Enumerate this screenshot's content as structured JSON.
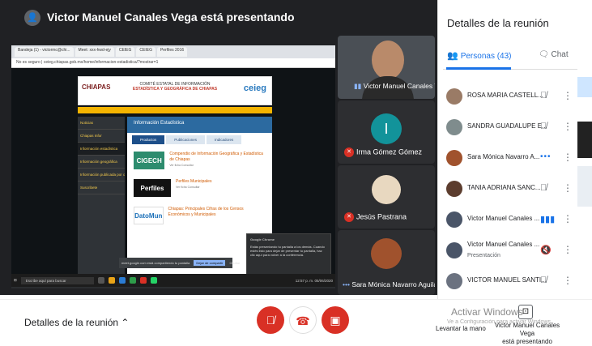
{
  "presenter_bar": {
    "title": "Victor Manuel Canales Vega está presentando"
  },
  "shared_screen": {
    "browser_tabs": [
      "Bandeja (1) - victormc@chi...",
      "Meet: xxx-hwd-ejy",
      "CEIEG",
      "CEIEG",
      "Perfiles 2016"
    ],
    "address": "No es seguro | ceieg.chiapas.gob.mx/home/informacion-estadistica/?mostrar=1",
    "site": {
      "brand_left": "CHIAPAS",
      "brand_center_line1": "COMITÉ ESTATAL DE INFORMACIÓN",
      "brand_center_line2": "ESTADÍSTICA Y GEOGRÁFICA DE CHIAPAS",
      "brand_right": "ceieg",
      "menu": [
        "Noticias",
        "Chiapas Infor",
        "Información estadística",
        "Información geográfica",
        "Información publicada por otras organizaciones",
        "Suscribete"
      ],
      "panel_title": "Información Estadística",
      "panel_tabs": [
        "Productos",
        "Publicaciones",
        "Indicadores"
      ],
      "items": [
        {
          "logo": "CIGECH",
          "title": "Compendio de Información Geográfica y Estadística de Chiapas",
          "meta": "Ver ficha  Consultar"
        },
        {
          "logo": "Perfiles",
          "title": "Perfiles Municipales",
          "meta": "Ver ficha  Consultar"
        },
        {
          "logo": "DatoMun",
          "title": "Chiapas: Principales Cifras de los Censos Económicos y Municipales",
          "meta": ""
        }
      ]
    },
    "notification": {
      "app": "Google Chrome",
      "text": "Estás presentando tu pantalla a los demás. Cuando estés listo para dejar de presentar tu pantalla, haz clic aquí para volver a la conferencia."
    },
    "share_banner": {
      "text": "meet.google.com está compartiendo tu pantalla",
      "stop": "Dejar de compartir",
      "hide": "Ocultar"
    },
    "taskbar": {
      "search": "Escribe aquí para buscar",
      "time": "12:57 p. m.",
      "date": "05/06/2020"
    }
  },
  "tiles": [
    {
      "name": "Victor Manuel Canales Vega",
      "muted": false
    },
    {
      "name": "Irma Gómez Gómez",
      "muted": true,
      "initial": "I"
    },
    {
      "name": "Jesús Pastrana",
      "muted": true
    },
    {
      "name": "Sara Mónica Navarro Aguilar",
      "muted": false
    }
  ],
  "side_panel": {
    "title": "Detalles de la reunión",
    "tab_people": "Personas (43)",
    "tab_chat": "Chat",
    "people": [
      {
        "name": "ROSA MARIA CASTELL...",
        "sub": "",
        "mic": "muted"
      },
      {
        "name": "SANDRA GUADALUPE E...",
        "sub": "",
        "mic": "muted"
      },
      {
        "name": "Sara Mónica Navarro A...",
        "sub": "",
        "mic": "dots"
      },
      {
        "name": "TANIA ADRIANA SANC...",
        "sub": "",
        "mic": "muted"
      },
      {
        "name": "Victor Manuel Canales ...",
        "sub": "",
        "mic": "active"
      },
      {
        "name": "Victor Manuel Canales ...",
        "sub": "Presentación",
        "mic": "present-off"
      },
      {
        "name": "VICTOR MANUEL SANTI...",
        "sub": "",
        "mic": "muted"
      }
    ]
  },
  "bottom_bar": {
    "details": "Detalles de la reunión",
    "raise_hand": "Levantar la mano",
    "presenting_line1": "Victor Manuel Canales Vega",
    "presenting_line2": "está presentando",
    "watermark": "Activar Windows",
    "watermark_sub": "Ve a Configuración para activar Windows."
  },
  "colors": {
    "accent": "#1a73e8",
    "danger": "#d93025",
    "dark": "#202124"
  }
}
